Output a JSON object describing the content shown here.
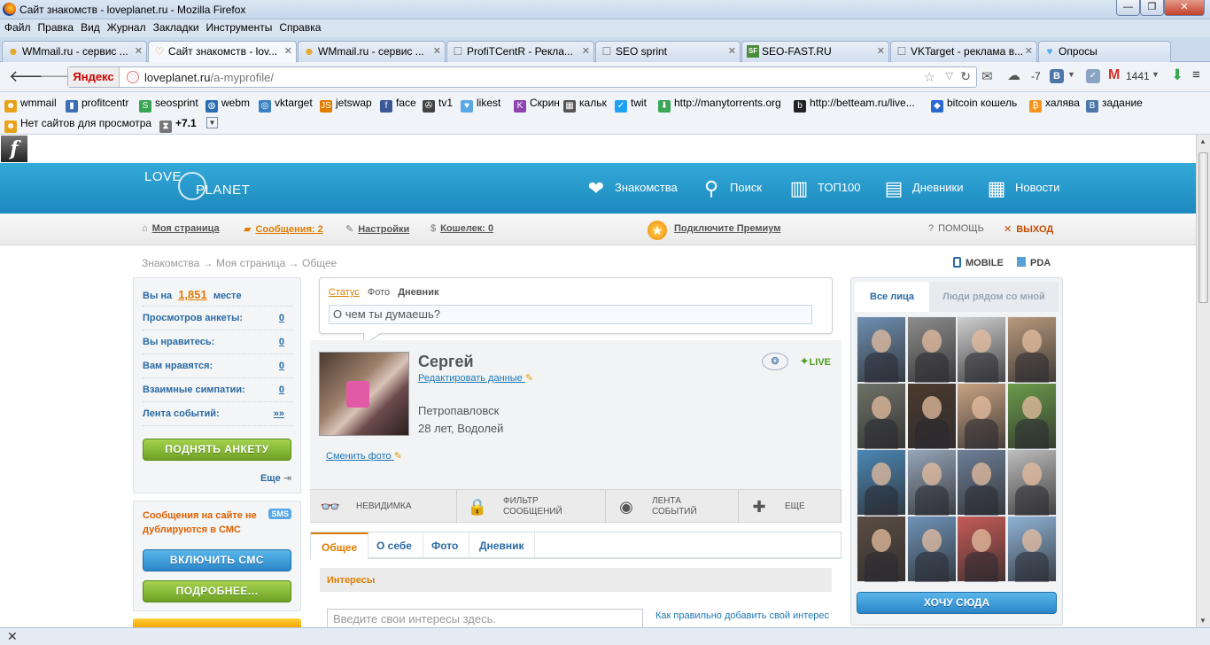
{
  "window": {
    "title": "Сайт знакомств - loveplanet.ru - Mozilla Firefox",
    "minimize": "—",
    "maximize": "❐",
    "close": "✕"
  },
  "menu": [
    "Файл",
    "Правка",
    "Вид",
    "Журнал",
    "Закладки",
    "Инструменты",
    "Справка"
  ],
  "tabs": [
    {
      "label": "WMmail.ru - сервис ...",
      "icon": "wmmail-icon",
      "glyph": "☻",
      "color": "#e8a21a",
      "active": false
    },
    {
      "label": "Сайт знакомств - lov...",
      "icon": "heart-icon",
      "glyph": "♡",
      "color": "#d98f18",
      "active": true
    },
    {
      "label": "WMmail.ru - сервис ...",
      "icon": "wmmail-icon",
      "glyph": "☻",
      "color": "#e8a21a",
      "active": false
    },
    {
      "label": "ProfiTCentR - Рекла...",
      "icon": "page-icon",
      "glyph": "☐",
      "color": "#777777",
      "active": false
    },
    {
      "label": "SEO sprint",
      "icon": "page-icon",
      "glyph": "☐",
      "color": "#777777",
      "active": false
    },
    {
      "label": "SEO-FAST.RU",
      "icon": "sf-icon",
      "glyph": "SF",
      "color": "#4a8b3c",
      "active": false
    },
    {
      "label": "VKTarget - реклама в...",
      "icon": "page-icon",
      "glyph": "☐",
      "color": "#777777",
      "active": false
    },
    {
      "label": "Опросы",
      "icon": "blue-heart-icon",
      "glyph": "♥",
      "color": "#5aa9e6",
      "active": false
    }
  ],
  "tab_close": "✕",
  "nav": {
    "yandex": "Яндекс",
    "url_host": "loveplanet.ru",
    "url_path": "/a-myprofile/",
    "weather": "-7",
    "gmail_count": "1441"
  },
  "bookmarks1": [
    {
      "label": "wmmail",
      "icon": "wmmail-icon",
      "color": "#e8a21a",
      "glyph": "☻"
    },
    {
      "label": "profitcentr",
      "icon": "chart-icon",
      "color": "#3c6fb4",
      "glyph": "▮"
    },
    {
      "label": "seosprint",
      "icon": "seosprint-icon",
      "color": "#3aa655",
      "glyph": "S"
    },
    {
      "label": "webm",
      "icon": "globe-icon",
      "color": "#2b6db1",
      "glyph": "◍"
    },
    {
      "label": "vktarget",
      "icon": "target-icon",
      "color": "#3b7fc4",
      "glyph": "◎"
    },
    {
      "label": "jetswap",
      "icon": "jetswap-icon",
      "color": "#e07d00",
      "glyph": "JS"
    },
    {
      "label": "face",
      "icon": "facebook-icon",
      "color": "#3b5998",
      "glyph": "f"
    },
    {
      "label": "tv1",
      "icon": "tv-icon",
      "color": "#444444",
      "glyph": "✇"
    },
    {
      "label": "likest",
      "icon": "likest-heart-icon",
      "color": "#5aa9e6",
      "glyph": "♥"
    },
    {
      "label": "Скрин",
      "icon": "k-icon",
      "color": "#8e44ad",
      "glyph": "K"
    },
    {
      "label": "кальк",
      "icon": "calculator-icon",
      "color": "#555555",
      "glyph": "▦"
    },
    {
      "label": "twit",
      "icon": "twitter-icon",
      "color": "#1da1f2",
      "glyph": "✓"
    },
    {
      "label": "http://manytorrents.org",
      "icon": "torrent-icon",
      "color": "#3aa655",
      "glyph": "⬇"
    },
    {
      "label": "http://betteam.ru/live...",
      "icon": "b-icon",
      "color": "#222222",
      "glyph": "b"
    },
    {
      "label": "bitcoin кошель",
      "icon": "cube-icon",
      "color": "#2a6ad0",
      "glyph": "◆"
    },
    {
      "label": "халява",
      "icon": "bitcoin-icon",
      "color": "#f7931a",
      "glyph": "₿"
    },
    {
      "label": "задание",
      "icon": "vk-icon",
      "color": "#4a76a8",
      "glyph": "B"
    }
  ],
  "bookmarks2": [
    {
      "label": "Нет сайтов для просмотра",
      "icon": "wmmail-icon",
      "color": "#e8a21a",
      "glyph": "☻"
    },
    {
      "label": "+7.1",
      "icon": "hourglass-icon",
      "color": "#777777",
      "glyph": "⧗"
    }
  ],
  "site": {
    "logo_top": "LOVE",
    "logo_bottom": "PLANET",
    "topnav": [
      {
        "label": "Знакомства",
        "icon": "heart-plus-icon",
        "glyph": "❤"
      },
      {
        "label": "Поиск",
        "icon": "search-heart-icon",
        "glyph": "⚲"
      },
      {
        "label": "ТОП100",
        "icon": "bars-icon",
        "glyph": "▥"
      },
      {
        "label": "Дневники",
        "icon": "diary-icon",
        "glyph": "▤"
      },
      {
        "label": "Новости",
        "icon": "news-icon",
        "glyph": "▦"
      }
    ],
    "subnav": {
      "my_page": "Моя страница",
      "messages": "Сообщения: 2",
      "settings": "Настройки",
      "wallet": "Кошелек: 0",
      "premium": "Подключите Премиум",
      "help": "ПОМОЩЬ",
      "logout": "ВЫХОД"
    },
    "breadcrumb": [
      "Знакомства",
      "Моя страница",
      "Общее"
    ],
    "breadcrumb_sep": "→",
    "mobile": "MOBILE",
    "pda": "PDA"
  },
  "left": {
    "rank_prefix": "Вы на",
    "rank": "1,851",
    "rank_suffix": "месте",
    "stats": [
      {
        "label": "Просмотров анкеты:",
        "value": "0"
      },
      {
        "label": "Вы нравитесь:",
        "value": "0"
      },
      {
        "label": "Вам нравятся:",
        "value": "0"
      },
      {
        "label": "Взаимные симпатии:",
        "value": "0"
      },
      {
        "label": "Лента событий:",
        "value": "»»"
      }
    ],
    "raise_button": "ПОДНЯТЬ АНКЕТУ",
    "more": "Еще",
    "sms_text": "Сообщения на сайте не дублируются в СМС",
    "sms_badge": "SMS",
    "enable_sms": "ВКЛЮЧИТЬ СМС",
    "details": "ПОДРОБНЕЕ..."
  },
  "status": {
    "tabs": [
      "Статус",
      "Фото",
      "Дневник"
    ],
    "placeholder": "О чем ты думаешь?"
  },
  "profile": {
    "name": "Сергей",
    "edit": "Редактировать данные",
    "city": "Петропавловск",
    "age": "28 лет, Водолей",
    "change_photo": "Сменить фото",
    "live": "LIVE"
  },
  "actions": [
    {
      "line1": "НЕВИДИМКА",
      "line2": "",
      "icon": "glasses-icon",
      "glyph": "👓"
    },
    {
      "line1": "ФИЛЬТР",
      "line2": "СООБЩЕНИЙ",
      "icon": "lock-icon",
      "glyph": "🔒"
    },
    {
      "line1": "ЛЕНТА",
      "line2": "СОБЫТИЙ",
      "icon": "record-icon",
      "glyph": "◉"
    },
    {
      "line1": "ЕЩЕ",
      "line2": "",
      "icon": "plus-icon",
      "glyph": "✚"
    }
  ],
  "profile_tabs": [
    "Общее",
    "О себе",
    "Фото",
    "Дневник"
  ],
  "interests": {
    "title": "Интересы",
    "placeholder": "Введите свои интересы здесь.",
    "help": "Как правильно добавить свой интерес"
  },
  "right": {
    "tab_all": "Все лица",
    "tab_near": "Люди рядом со мной",
    "want_here": "ХОЧУ СЮДА",
    "faces": [
      "#6f8fb2",
      "#8d8d8d",
      "#cfcfcf",
      "#b99a7d",
      "#6f7268",
      "#4b3a2f",
      "#c9a383",
      "#6c9b4b",
      "#4c87b5",
      "#95a5b9",
      "#6d7f98",
      "#bdbdbd",
      "#5b4e44",
      "#6e93b8",
      "#c65b57",
      "#8fb4d8"
    ]
  }
}
